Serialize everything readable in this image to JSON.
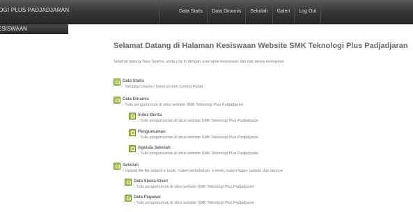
{
  "header": {
    "brand": "OGI PLUS PADJADJARAN",
    "nav": [
      "Data Statis",
      "Data Dinamis",
      "Sekolah",
      "Galeri",
      "Log Out"
    ]
  },
  "subbar": {
    "label": "ESISWAAN"
  },
  "main": {
    "title": "Selamat Datang di Halaman Kesiswaan Website SMK Teknologi Plus Padjadjaran",
    "intro": "Selamat datang Tiara Syahra, anda Log In dengan username kesiswaan dan hak akses kesiswaan",
    "items": [
      {
        "title": "Data Statis",
        "desc": "- Tampilan utama / home screen Control Panel"
      },
      {
        "title": "Data Dinamis",
        "desc": "- Tulis pengumuman di situs website SMK Teknologi Plus Padjadjaran"
      },
      {
        "title": "Index Berita",
        "desc": "- Tulis pengumuman di situs website SMK Teknologi Plus Padjadjaran"
      },
      {
        "title": "Pengumuman",
        "desc": "- Tulis pengumuman di situs website SMK Teknologi Plus Padjadjaran"
      },
      {
        "title": "Agenda Sekolah",
        "desc": "- Tulis pengumuman di situs website SMK Teknologi Plus Padjadjaran"
      },
      {
        "title": "Sekolah",
        "desc": "- Upload file-file seperti e-book, materi perkuliahan, e-book, materi tugas, jadwal, dan lainnya"
      },
      {
        "title": "Data Siswa-Siswi",
        "desc": "- Tulis pengumuman di situs website SMK Teknologi Plus Padjadjaran"
      },
      {
        "title": "Data Pegawai",
        "desc": "- Tulis pengumuman di situs website SMK Teknologi Plus Padjadjaran"
      }
    ]
  }
}
